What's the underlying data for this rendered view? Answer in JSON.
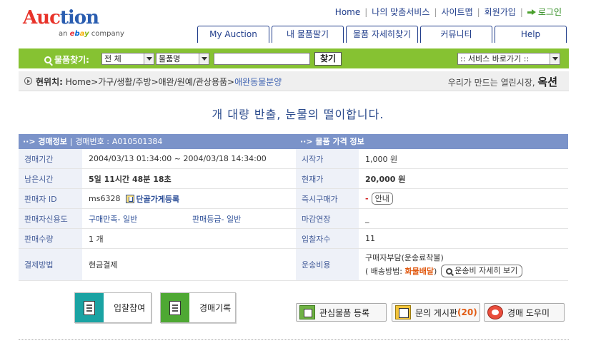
{
  "header": {
    "logo_text_a": "Auc",
    "logo_text_b": "tion",
    "logo_sub_prefix": "an",
    "logo_sub_suffix": "company",
    "ebay": [
      "e",
      "b",
      "a",
      "y"
    ],
    "topnav": [
      "Home",
      "나의 맞춤서비스",
      "사이트맵",
      "회원가입"
    ],
    "login_label": "로그인",
    "tabs": [
      "My Auction",
      "내 물품팔기",
      "물품 자세히찾기",
      "커뮤니티",
      "Help"
    ]
  },
  "search": {
    "label": "물품찾기:",
    "category_select": "전 체",
    "field_select": "물품명",
    "keyword_value": "",
    "find_button": "찾기",
    "service_select": ":: 서비스 바로가기 ::"
  },
  "breadcrumb": {
    "prefix": "현위치:",
    "path": "Home>가구/생활/주방>애완/원예/관상용품>",
    "current": "애완동물분양",
    "slogan_pre": "우리가 만드는",
    "slogan_mid": "열린시장,",
    "slogan_brand": "옥션"
  },
  "item_title": "개 대량 반출, 눈물의 떨이합니다.",
  "auction_info": {
    "header_title": "경매정보",
    "header_sep": "|",
    "header_no_label": "경매번호 :",
    "header_no_value": "A010501384",
    "rows": {
      "period_label": "경매기간",
      "period_value": "2004/03/13 01:34:00 ~ 2004/03/18 14:34:00",
      "remaining_label": "남은시간",
      "remaining_value": "5일 11시간 48분 18초",
      "seller_label": "판매자 ID",
      "seller_value": "ms6328",
      "seller_regular": "단골가게등록",
      "credit_label": "판매자신용도",
      "credit_satisfaction": "구매만족- 일반",
      "credit_grade": "판매등급- 일반",
      "qty_label": "판매수량",
      "qty_value": "1 개",
      "payment_label": "결제방법",
      "payment_value": "현금결제"
    }
  },
  "price_info": {
    "header_title": "물품 가격 정보",
    "rows": {
      "start_label": "시작가",
      "start_value": "1,000 원",
      "current_label": "현재가",
      "current_value": "20,000 원",
      "buynow_label": "즉시구매가",
      "buynow_value": "-",
      "buynow_guide": "안내",
      "extend_label": "마감연장",
      "extend_value": "_",
      "bids_label": "입찰자수",
      "bids_value": "11",
      "ship_label": "운송비용",
      "ship_line1": "구매자부담(운송료착불)",
      "ship_line2_pre": "( 배송방법:",
      "ship_method": "화물배달",
      "ship_line2_post": ")",
      "ship_detail": "운송비 자세히 보기"
    }
  },
  "actions": {
    "bid": "입찰참여",
    "history": "경매기록",
    "watch": "관심물품 등록",
    "board": "문의 게시판",
    "board_count": "(20)",
    "helper": "경매 도우미"
  }
}
